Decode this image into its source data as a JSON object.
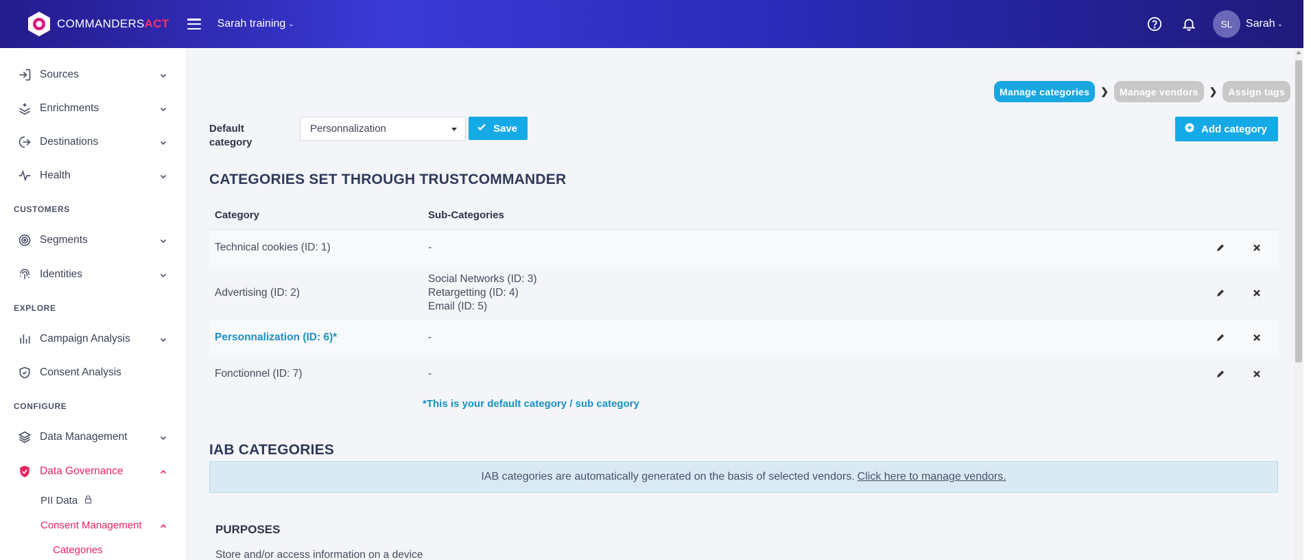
{
  "brand": {
    "name": "COMMANDERS",
    "accent_word": "ACT",
    "accent_color": "#ff2e63"
  },
  "header": {
    "workspace": "Sarah training",
    "user_initials": "SL",
    "user_name": "Sarah",
    "icons": [
      "hamburger-icon",
      "help-icon",
      "bell-icon"
    ]
  },
  "sidebar": {
    "items": [
      {
        "label": "Sources",
        "icon": "arrow-in-icon"
      },
      {
        "label": "Enrichments",
        "icon": "layers-plus-icon"
      },
      {
        "label": "Destinations",
        "icon": "arrow-out-icon"
      },
      {
        "label": "Health",
        "icon": "pulse-icon"
      },
      {
        "label": "Segments",
        "icon": "target-icon"
      },
      {
        "label": "Identities",
        "icon": "fingerprint-icon"
      },
      {
        "label": "Campaign Analysis",
        "icon": "bar-chart-icon"
      },
      {
        "label": "Consent Analysis",
        "icon": "shield-check-icon"
      },
      {
        "label": "Data Management",
        "icon": "stack-icon"
      },
      {
        "label": "Data Governance",
        "icon": "shield-icon"
      }
    ],
    "sections": {
      "customers": "CUSTOMERS",
      "explore": "EXPLORE",
      "configure": "CONFIGURE"
    },
    "sub": {
      "pii": "PII Data",
      "consent": "Consent Management",
      "categories": "Categories"
    },
    "active_color": "#e8245f"
  },
  "steps": {
    "manage_categories": "Manage categories",
    "manage_vendors": "Manage vendors",
    "assign_tags": "Assign tags"
  },
  "form": {
    "default_label_1": "Default",
    "default_label_2": "category",
    "selected": "Personnalization",
    "save": "Save",
    "add_category": "Add category"
  },
  "tc_section": {
    "title": "CATEGORIES SET THROUGH TRUSTCOMMANDER",
    "col_category": "Category",
    "col_sub": "Sub-Categories",
    "rows": [
      {
        "category": "Technical cookies (ID: 1)",
        "subs": [
          "-"
        ]
      },
      {
        "category": "Advertising (ID: 2)",
        "subs": [
          "Social Networks (ID: 3)",
          "Retargetting (ID: 4)",
          "Email (ID: 5)"
        ]
      },
      {
        "category": "Personnalization (ID: 6)*",
        "subs": [
          "-"
        ]
      },
      {
        "category": "Fonctionnel (ID: 7)",
        "subs": [
          "-"
        ]
      }
    ],
    "note": "*This is your default category / sub category"
  },
  "iab": {
    "title": "IAB CATEGORIES",
    "info": "IAB categories are automatically generated on the basis of selected vendors.",
    "link": "Click here to manage vendors."
  },
  "purposes": {
    "title": "PURPOSES",
    "first": "Store and/or access information on a device"
  },
  "colors": {
    "primary": "#15a9e6",
    "step_inactive": "#c9c7c8",
    "link": "#1a8fc4"
  }
}
